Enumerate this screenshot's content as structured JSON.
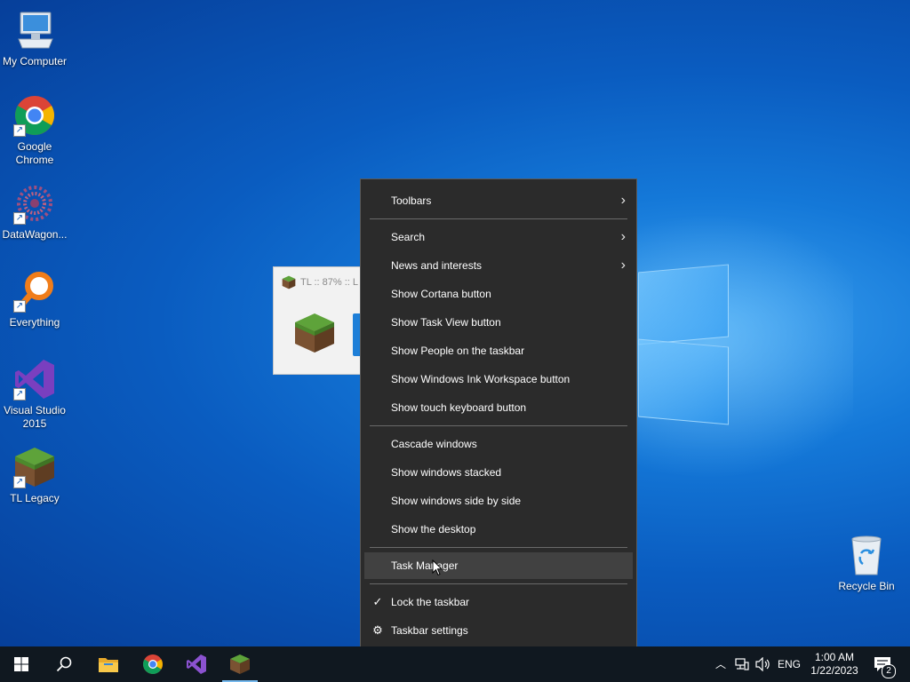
{
  "desktop": {
    "icons": [
      {
        "label_line1": "My Computer",
        "label_line2": ""
      },
      {
        "label_line1": "Google",
        "label_line2": "Chrome"
      },
      {
        "label_line1": "DataWagon...",
        "label_line2": ""
      },
      {
        "label_line1": "Everything",
        "label_line2": ""
      },
      {
        "label_line1": "Visual Studio",
        "label_line2": "2015"
      },
      {
        "label_line1": "TL Legacy",
        "label_line2": ""
      },
      {
        "label_line1": "Recycle Bin",
        "label_line2": ""
      }
    ]
  },
  "thumbnail": {
    "title": "TL :: 87% :: L"
  },
  "context_menu": {
    "items": [
      {
        "label": "Toolbars",
        "icon": "chevron-right-icon"
      },
      {
        "label": "Search",
        "icon": "chevron-right-icon"
      },
      {
        "label": "News and interests",
        "icon": "chevron-right-icon"
      },
      {
        "label": "Show Cortana button"
      },
      {
        "label": "Show Task View button"
      },
      {
        "label": "Show People on the taskbar"
      },
      {
        "label": "Show Windows Ink Workspace button"
      },
      {
        "label": "Show touch keyboard button"
      },
      {
        "label": "Cascade windows"
      },
      {
        "label": "Show windows stacked"
      },
      {
        "label": "Show windows side by side"
      },
      {
        "label": "Show the desktop"
      },
      {
        "label": "Task Manager"
      },
      {
        "label": "Lock the taskbar",
        "icon": "checkmark-icon",
        "checked": true
      },
      {
        "label": "Taskbar settings",
        "icon": "gear-icon"
      }
    ],
    "highlighted": "Task Manager"
  },
  "taskbar": {
    "buttons": [
      "start-icon",
      "search-icon",
      "file-explorer-icon",
      "chrome-icon",
      "visual-studio-icon",
      "tl-legacy-icon"
    ],
    "tray": {
      "language": "ENG",
      "time": "1:00 AM",
      "date": "1/22/2023",
      "notification_count": "2"
    }
  },
  "colors": {
    "menu_bg": "#2b2b2b",
    "menu_highlight": "#414141",
    "taskbar_bg": "#101820",
    "accent": "#76b9ed"
  }
}
